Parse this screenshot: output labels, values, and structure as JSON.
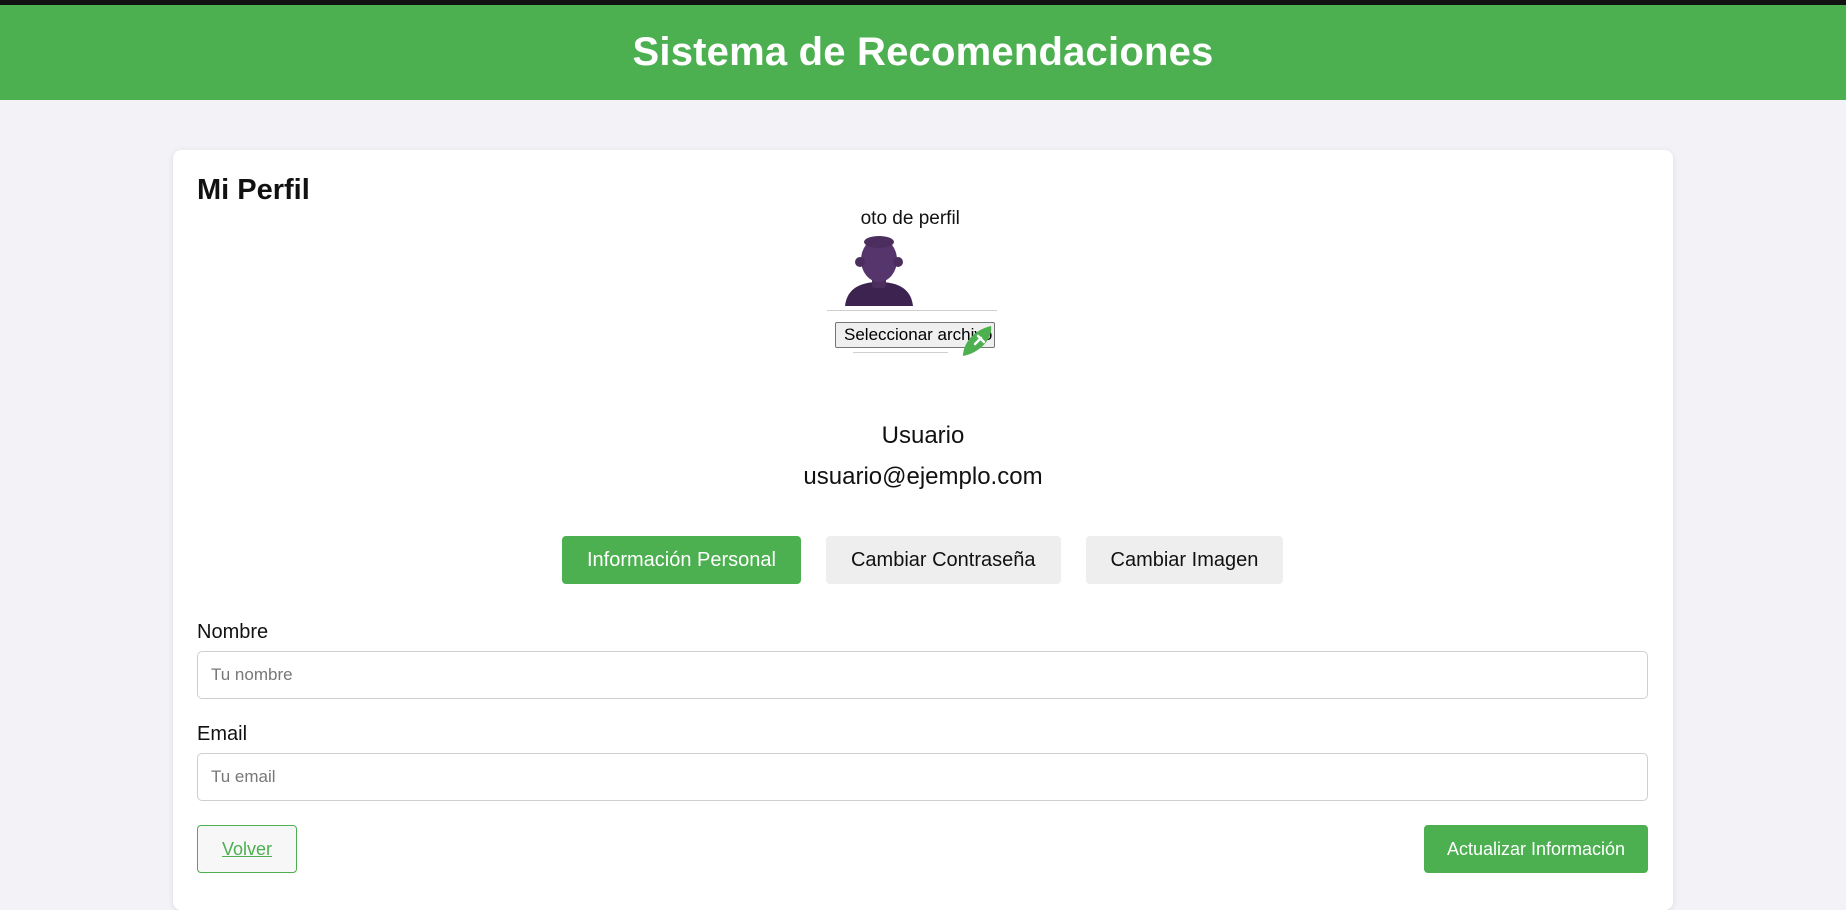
{
  "header": {
    "title": "Sistema de Recomendaciones"
  },
  "profile": {
    "section_title": "Mi Perfil",
    "avatar_alt_text": "Foto de perfil",
    "file_button_label": "Seleccionar archivo",
    "user_name": "Usuario",
    "user_email": "usuario@ejemplo.com"
  },
  "tabs": [
    {
      "label": "Información Personal",
      "active": true
    },
    {
      "label": "Cambiar Contraseña",
      "active": false
    },
    {
      "label": "Cambiar Imagen",
      "active": false
    }
  ],
  "form": {
    "name_label": "Nombre",
    "name_placeholder": "Tu nombre",
    "name_value": "",
    "email_label": "Email",
    "email_placeholder": "Tu email",
    "email_value": ""
  },
  "actions": {
    "back_label": "Volver",
    "update_label": "Actualizar Información"
  },
  "colors": {
    "accent": "#4caf50",
    "background": "#f3f3f7",
    "avatar": "#4b2e5e"
  },
  "icons": {
    "avatar": "user-silhouette-icon",
    "edit": "pencil-icon"
  }
}
